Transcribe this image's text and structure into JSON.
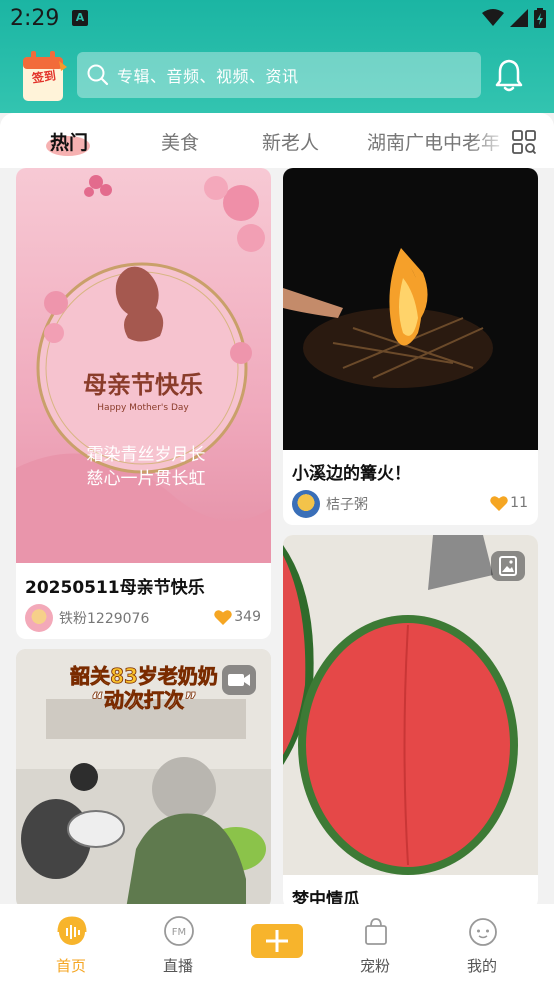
{
  "status_bar": {
    "time": "2:29",
    "notif_badge": "A"
  },
  "header": {
    "signin_label": "签到",
    "search_placeholder": "专辑、音频、视频、资讯"
  },
  "tabs": [
    {
      "label": "热门",
      "active": true
    },
    {
      "label": "美食",
      "active": false
    },
    {
      "label": "新老人",
      "active": false
    },
    {
      "label": "湖南广电中老年",
      "active": false
    }
  ],
  "feed": {
    "left": [
      {
        "title": "20250511母亲节快乐",
        "author": "铁粉1229076",
        "likes": "349",
        "image_text": {
          "main": "母亲节快乐",
          "sub": "Happy Mother's Day",
          "poem1": "霜染青丝岁月长",
          "poem2": "慈心一片贯长虹"
        }
      },
      {
        "title": "",
        "image_text": {
          "main": "韶关83岁老奶奶",
          "sub": "“动次打次”"
        }
      }
    ],
    "right": [
      {
        "title": "小溪边的篝火！",
        "author": "桔子粥",
        "likes": "11"
      },
      {
        "title": "梦中情瓜"
      }
    ]
  },
  "bottom_nav": [
    {
      "label": "首页",
      "icon": "home-music-icon",
      "active": true
    },
    {
      "label": "直播",
      "icon": "fm-radio-icon",
      "active": false
    },
    {
      "label": "",
      "icon": "plus-icon",
      "active": false
    },
    {
      "label": "宠粉",
      "icon": "shopping-bag-icon",
      "active": false
    },
    {
      "label": "我的",
      "icon": "profile-face-icon",
      "active": false
    }
  ],
  "colors": {
    "teal": "#1bb5a3",
    "accent": "#f5a623",
    "heart": "#f5a623"
  }
}
